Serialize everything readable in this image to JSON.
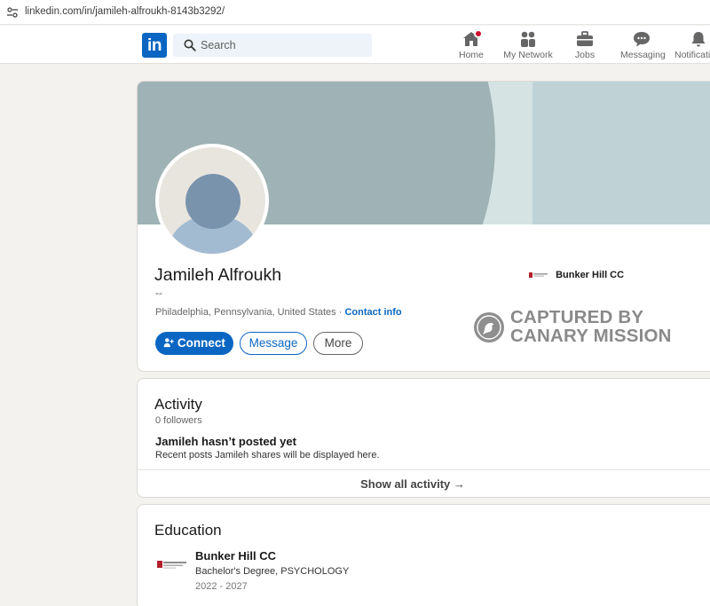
{
  "browser": {
    "url": "linkedin.com/in/jamileh-alfroukh-8143b3292/"
  },
  "nav": {
    "logo": "in",
    "search_placeholder": "Search",
    "items": [
      {
        "label": "Home",
        "icon": "home-icon"
      },
      {
        "label": "My Network",
        "icon": "network-icon"
      },
      {
        "label": "Jobs",
        "icon": "briefcase-icon"
      },
      {
        "label": "Messaging",
        "icon": "messaging-icon"
      },
      {
        "label": "Notifications",
        "icon": "bell-icon"
      }
    ]
  },
  "profile": {
    "name": "Jamileh Alfroukh",
    "headline": "--",
    "location": "Philadelphia, Pennsylvania, United States",
    "separator": "·",
    "contact_info": "Contact info",
    "connect_label": "Connect",
    "message_label": "Message",
    "more_label": "More",
    "side_school": "Bunker Hill CC"
  },
  "watermark": {
    "line1": "CAPTURED BY",
    "line2": "CANARY MISSION"
  },
  "activity": {
    "title": "Activity",
    "followers": "0 followers",
    "empty_title": "Jamileh hasn’t posted yet",
    "empty_subtitle": "Recent posts Jamileh shares will be displayed here.",
    "show_all": "Show all activity →"
  },
  "education": {
    "title": "Education",
    "school": "Bunker Hill CC",
    "degree": "Bachelor's Degree, PSYCHOLOGY",
    "years": "2022 - 2027"
  },
  "colors": {
    "linkedin_blue": "#0a66c2",
    "notification_red": "#cb112d"
  }
}
